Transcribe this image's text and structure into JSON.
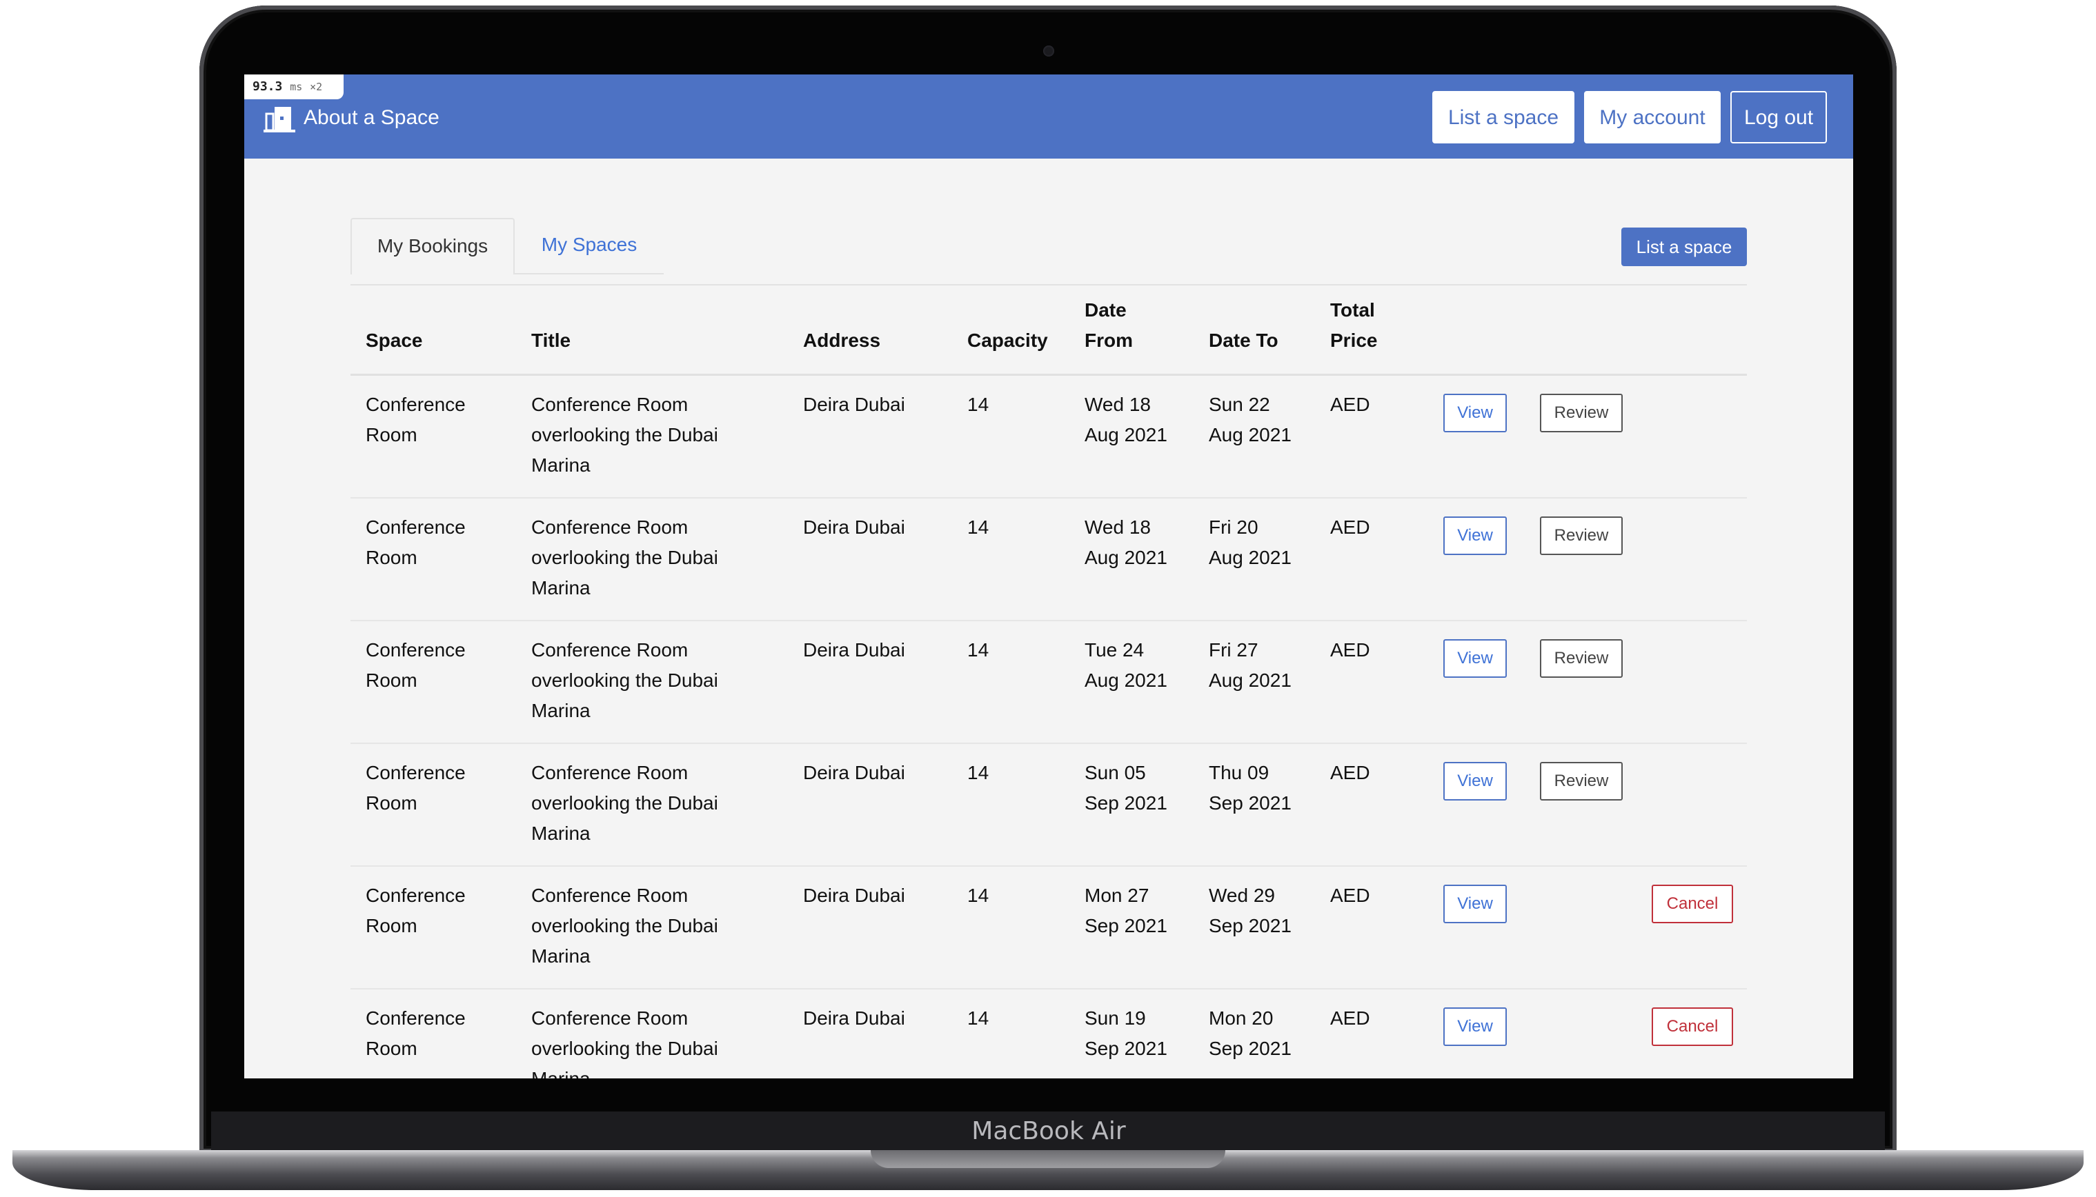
{
  "device": {
    "brand_label": "MacBook Air"
  },
  "perf_badge": {
    "time": "93.3",
    "unit": "ms",
    "multiplier": "×2"
  },
  "navbar": {
    "brand": "About a Space",
    "list_space_label": "List a space",
    "my_account_label": "My account",
    "logout_label": "Log out",
    "bg_color": "#4d72c4"
  },
  "tabs": [
    {
      "label": "My Bookings",
      "active": true
    },
    {
      "label": "My Spaces",
      "active": false
    }
  ],
  "list_space_button": "List a space",
  "table": {
    "headers": {
      "space": "Space",
      "title": "Title",
      "address": "Address",
      "capacity": "Capacity",
      "date_from_1": "Date",
      "date_from_2": "From",
      "date_to": "Date To",
      "total_price_1": "Total",
      "total_price_2": "Price"
    },
    "rows": [
      {
        "space_1": "Conference",
        "space_2": "Room",
        "title_1": "Conference Room",
        "title_2": "overlooking the Dubai",
        "title_3": "Marina",
        "address": "Deira Dubai",
        "capacity": "14",
        "from_1": "Wed 18",
        "from_2": "Aug 2021",
        "to_1": "Sun 22",
        "to_2": "Aug 2021",
        "price": "AED",
        "view": "View",
        "action": "Review"
      },
      {
        "space_1": "Conference",
        "space_2": "Room",
        "title_1": "Conference Room",
        "title_2": "overlooking the Dubai",
        "title_3": "Marina",
        "address": "Deira Dubai",
        "capacity": "14",
        "from_1": "Wed 18",
        "from_2": "Aug 2021",
        "to_1": "Fri 20",
        "to_2": "Aug 2021",
        "price": "AED",
        "view": "View",
        "action": "Review"
      },
      {
        "space_1": "Conference",
        "space_2": "Room",
        "title_1": "Conference Room",
        "title_2": "overlooking the Dubai",
        "title_3": "Marina",
        "address": "Deira Dubai",
        "capacity": "14",
        "from_1": "Tue 24",
        "from_2": "Aug 2021",
        "to_1": "Fri 27",
        "to_2": "Aug 2021",
        "price": "AED",
        "view": "View",
        "action": "Review"
      },
      {
        "space_1": "Conference",
        "space_2": "Room",
        "title_1": "Conference Room",
        "title_2": "overlooking the Dubai",
        "title_3": "Marina",
        "address": "Deira Dubai",
        "capacity": "14",
        "from_1": "Sun 05",
        "from_2": "Sep 2021",
        "to_1": "Thu 09",
        "to_2": "Sep 2021",
        "price": "AED",
        "view": "View",
        "action": "Review"
      },
      {
        "space_1": "Conference",
        "space_2": "Room",
        "title_1": "Conference Room",
        "title_2": "overlooking the Dubai",
        "title_3": "Marina",
        "address": "Deira Dubai",
        "capacity": "14",
        "from_1": "Mon 27",
        "from_2": "Sep 2021",
        "to_1": "Wed 29",
        "to_2": "Sep 2021",
        "price": "AED",
        "view": "View",
        "action": "Cancel"
      },
      {
        "space_1": "Conference",
        "space_2": "Room",
        "title_1": "Conference Room",
        "title_2": "overlooking the Dubai",
        "title_3": "Marina",
        "address": "Deira Dubai",
        "capacity": "14",
        "from_1": "Sun 19",
        "from_2": "Sep 2021",
        "to_1": "Mon 20",
        "to_2": "Sep 2021",
        "price": "AED",
        "view": "View",
        "action": "Cancel"
      }
    ]
  }
}
